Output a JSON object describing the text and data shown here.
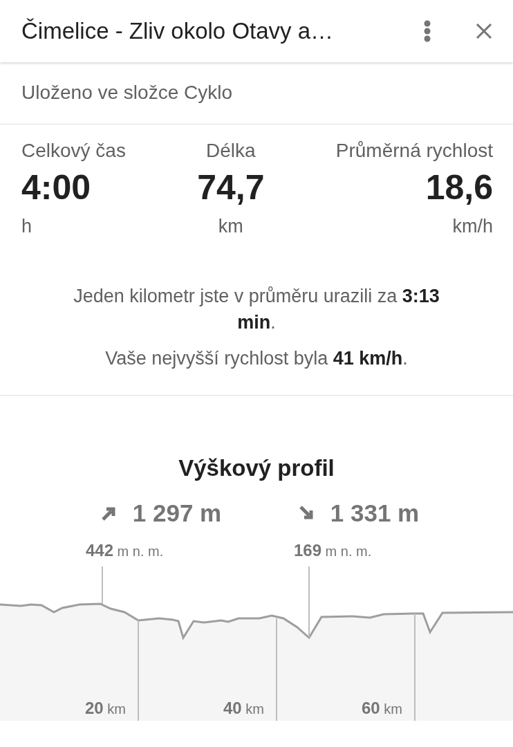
{
  "header": {
    "title": "Čimelice - Zliv okolo Otavy a…"
  },
  "folder_note": "Uloženo ve složce Cyklo",
  "stats": [
    {
      "label": "Celkový čas",
      "value": "4:00",
      "unit": "h"
    },
    {
      "label": "Délka",
      "value": "74,7",
      "unit": "km"
    },
    {
      "label": "Průměrná rychlost",
      "value": "18,6",
      "unit": "km/h"
    }
  ],
  "summary": [
    "Jeden kilometr jste v průměru urazili za **3:13 min**.",
    "Vaše nejvyšší rychlost byla **41 km/h**."
  ],
  "elevation": {
    "title": "Výškový profil",
    "totals": [
      {
        "kind": "ascent",
        "value": "1 297 m"
      },
      {
        "kind": "descent",
        "value": "1 331 m"
      }
    ],
    "markers": [
      {
        "value": "442",
        "unit": "m n. m."
      },
      {
        "value": "169",
        "unit": "m n. m."
      }
    ],
    "distance_labels": [
      {
        "value": "20",
        "unit": "km"
      },
      {
        "value": "40",
        "unit": "km"
      },
      {
        "value": "60",
        "unit": "km"
      }
    ]
  }
}
